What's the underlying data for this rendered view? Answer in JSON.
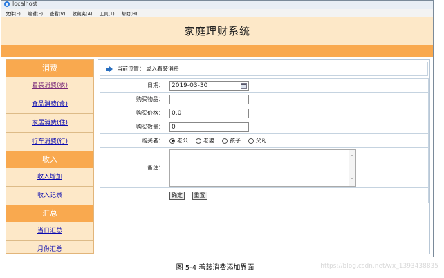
{
  "browser": {
    "tab_title": "localhost"
  },
  "menubar": {
    "items": [
      "文件(F)",
      "编辑(E)",
      "查看(V)",
      "收藏夹(A)",
      "工具(T)",
      "帮助(H)"
    ]
  },
  "header": {
    "title": "家庭理财系统"
  },
  "sidebar": {
    "sections": [
      {
        "title": "消费",
        "links": [
          "着装消费(衣)",
          "食品消费(食)",
          "家居消费(住)",
          "行车消费(行)"
        ]
      },
      {
        "title": "收入",
        "links": [
          "收入增加",
          "收入记录"
        ]
      },
      {
        "title": "汇总",
        "links": [
          "当日汇总",
          "月份汇总"
        ]
      }
    ],
    "active_link": "着装消费(衣)"
  },
  "breadcrumb": {
    "label": "当前位置：",
    "value": "录入着装消费"
  },
  "form": {
    "date": {
      "label": "日期：",
      "value": "2019-03-30"
    },
    "item": {
      "label": "购买物品：",
      "value": ""
    },
    "price": {
      "label": "购买价格：",
      "value": "0.0"
    },
    "quantity": {
      "label": "购买数量：",
      "value": "0"
    },
    "buyer": {
      "label": "购买者：",
      "options": [
        "老公",
        "老婆",
        "孩子",
        "父母"
      ],
      "selected": "老公"
    },
    "note": {
      "label": "备注：",
      "value": ""
    },
    "buttons": {
      "confirm": "确定",
      "reset": "重置"
    }
  },
  "caption": {
    "text": "图 5-4   着装消费添加界面"
  },
  "watermark": {
    "text": "https://blog.csdn.net/wx_1393438835"
  }
}
